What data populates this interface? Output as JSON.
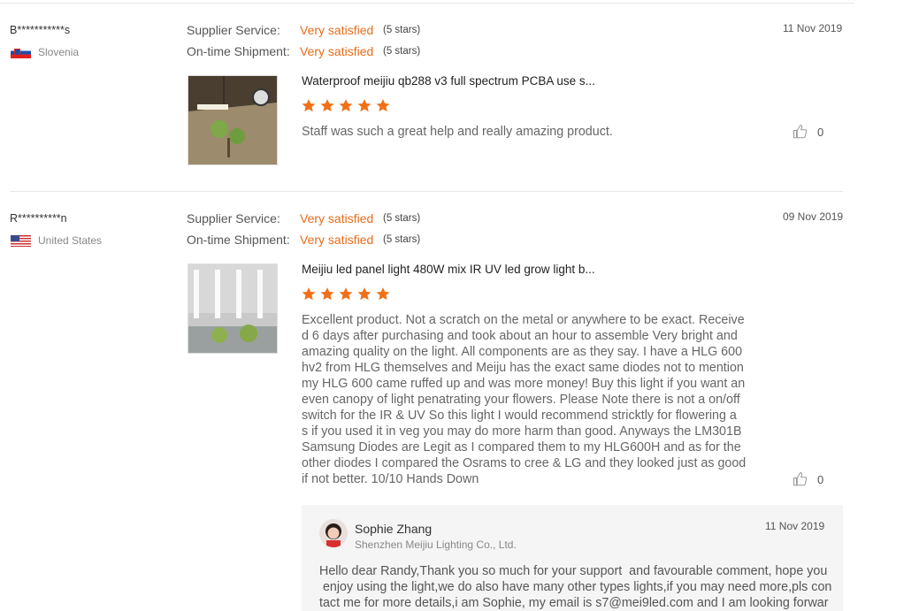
{
  "reviews": [
    {
      "user": "B***********s",
      "country": "Slovenia",
      "supplier_label": "Supplier Service:",
      "supplier_value": "Very satisfied",
      "supplier_stars": "(5 stars)",
      "shipment_label": "On-time Shipment:",
      "shipment_value": "Very satisfied",
      "shipment_stars": "(5 stars)",
      "date": "11 Nov 2019",
      "product_title": "Waterproof meijiu qb288 v3 full spectrum PCBA use s...",
      "rating": 5,
      "text": "Staff was such a great help and really amazing product.",
      "likes": "0"
    },
    {
      "user": "R**********n",
      "country": "United States",
      "supplier_label": "Supplier Service:",
      "supplier_value": "Very satisfied",
      "supplier_stars": "(5 stars)",
      "shipment_label": "On-time Shipment:",
      "shipment_value": "Very satisfied",
      "shipment_stars": "(5 stars)",
      "date": "09 Nov 2019",
      "product_title": "Meijiu led panel light 480W mix IR UV led grow light b...",
      "rating": 5,
      "text_lines": [
        "Excellent product. Not a scratch on the metal or anywhere to be exact. Receive",
        "d 6 days after purchasing and took about an hour to assemble Very bright and",
        "amazing quality on the light. All components are as they say. I have a HLG 600",
        "hv2 from HLG themselves and Meiju has the exact same diodes not to mention",
        "my HLG 600 came ruffed up and was more money! Buy this light if you want an",
        "even canopy of light penatrating your flowers. Please Note there is not a on/off",
        "switch for the IR & UV So this light I would recommend stricktly for flowering a",
        "s if you used it in veg you may do more harm than good. Anyways the LM301B",
        "Samsung Diodes are Legit as I compared them to my HLG600H and as for the",
        "other diodes I compared the Osrams to cree & LG and they looked just as good",
        "if not better. 10/10 Hands Down"
      ],
      "likes": "0",
      "reply": {
        "name": "Sophie Zhang",
        "company": "Shenzhen Meijiu Lighting Co., Ltd.",
        "date": "11 Nov 2019",
        "text_lines": [
          "Hello dear Randy,Thank you so much for your support  and favourable comment, hope you",
          " enjoy using the light,we do also have many other types lights,if you may need more,pls con",
          "tact me for more details,i am Sophie, my email is s7@mei9led.com and I am looking forwar"
        ]
      }
    }
  ],
  "colors": {
    "accent": "#e86c1a",
    "star": "#f07018"
  }
}
